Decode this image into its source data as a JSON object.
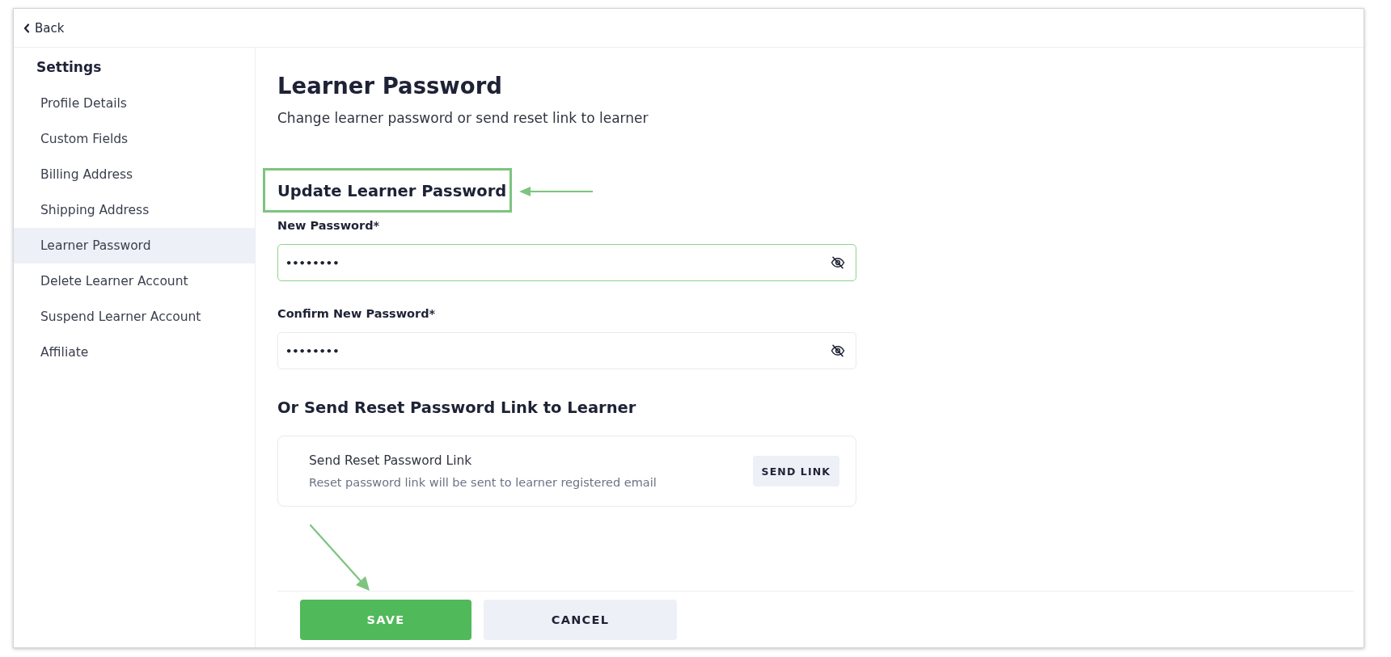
{
  "top_bar": {
    "back_label": "Back"
  },
  "sidebar": {
    "title": "Settings",
    "items": [
      {
        "label": "Profile Details",
        "selected": false
      },
      {
        "label": "Custom Fields",
        "selected": false
      },
      {
        "label": "Billing Address",
        "selected": false
      },
      {
        "label": "Shipping Address",
        "selected": false
      },
      {
        "label": "Learner Password",
        "selected": true
      },
      {
        "label": "Delete Learner Account",
        "selected": false
      },
      {
        "label": "Suspend Learner Account",
        "selected": false
      },
      {
        "label": "Affiliate",
        "selected": false
      }
    ]
  },
  "page": {
    "title": "Learner Password",
    "subtitle": "Change learner password or send reset link to learner"
  },
  "update_section": {
    "title": "Update Learner Password",
    "highlighted": true,
    "fields": [
      {
        "label": "New Password*",
        "value": "••••••••",
        "focused": true
      },
      {
        "label": "Confirm New Password*",
        "value": "••••••••",
        "focused": false
      }
    ]
  },
  "reset_section": {
    "title": "Or Send Reset Password Link to Learner",
    "card": {
      "title": "Send Reset Password Link",
      "description": "Reset password link will be sent to learner registered email",
      "button": "SEND LINK"
    }
  },
  "footer": {
    "buttons": [
      {
        "label": "SAVE",
        "kind": "primary"
      },
      {
        "label": "CANCEL",
        "kind": "secondary"
      }
    ]
  }
}
